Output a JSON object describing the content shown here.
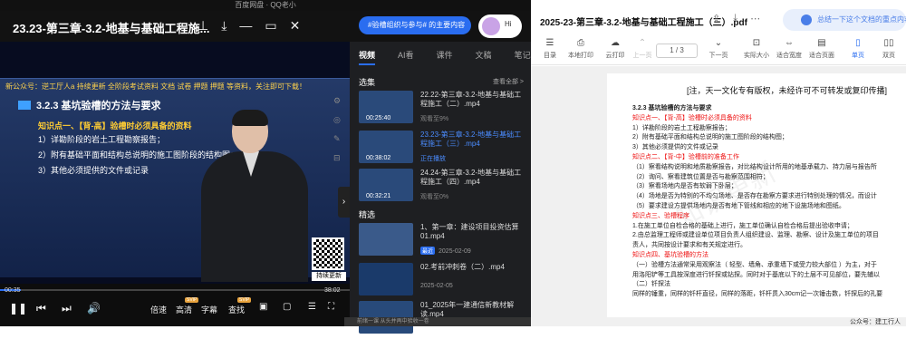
{
  "player": {
    "top_bar": "百度网盘 · QQ老小",
    "title": "23.23-第三章-3.2-地基与基础工程施...",
    "ai_pill": "#验槽组织与参与# 的主要内容",
    "ai_avatar_label": "Hi",
    "icons": [
      "pin-icon",
      "download-icon",
      "minimize-icon",
      "window-icon",
      "close-icon"
    ]
  },
  "slide": {
    "marquee": "新公众号：逆工厅人a 持续更新 全阶段考试资料 文档 试卷 押题 押题 等资料，关注即可下载！",
    "heading": "3.2.3  基坑验槽的方法与要求",
    "point": "知识点一、【背-高】验槽时必须具备的资料",
    "lines": [
      "1）详勘阶段的岩土工程勘察报告；",
      "2）附有基础平面和结构总说明的施工图阶段的结构图；",
      "3）其他必须提供的文件或记录"
    ],
    "qr_label": "持续更新"
  },
  "controls": {
    "time_current": "00:35",
    "time_total": "38:02",
    "progress": 0.06,
    "speed_label": "倍速",
    "quality_label": "高清",
    "subtitle_label": "字幕",
    "search_label": "查找",
    "badge_svip": "SVIP"
  },
  "panel": {
    "tabs": [
      "视频",
      "AI看",
      "课件",
      "文稿",
      "笔记"
    ],
    "active_tab": "视频",
    "selection_title": "选集",
    "see_all": "查看全部 >",
    "episodes": [
      {
        "title": "22.22-第三章-3.2-地基与基础工程施工（二）.mp4",
        "status": "观看至9%",
        "duration": "00:25:40",
        "current": false
      },
      {
        "title": "23.23-第三章-3.2-地基与基础工程施工（三）.mp4",
        "status": "正在播放",
        "duration": "00:38:02",
        "current": true
      },
      {
        "title": "24.24-第三章-3.2-地基与基础工程施工（四）.mp4",
        "status": "观看至0%",
        "duration": "00:32:21",
        "current": false
      }
    ],
    "featured_title": "精选",
    "featured": [
      {
        "title": "1、第一章：建设项目投资估算01.mp4",
        "date": "2025-02-09",
        "tag": "最近"
      },
      {
        "title": "02.考前冲刺卷（二）.mp4",
        "date": "2025-02-05",
        "tag": ""
      },
      {
        "title": "01_2025年一建通信新教材解读.mp4",
        "date": "",
        "tag": ""
      }
    ]
  },
  "pdf": {
    "title": "2025-23-第三章-3.2-地基与基础工程施工（三）.pdf",
    "ai_pill": "总结一下这个文档的重点内容",
    "toolbar": [
      {
        "label": "目录",
        "icon": "list-icon",
        "state": "normal"
      },
      {
        "label": "本地打印",
        "icon": "print-icon",
        "state": "normal"
      },
      {
        "label": "云打印",
        "icon": "cloud-print-icon",
        "state": "normal"
      },
      {
        "label": "上一页",
        "icon": "arrow-up-icon",
        "state": "disabled"
      },
      {
        "label": "下一页",
        "icon": "arrow-down-icon",
        "state": "normal"
      },
      {
        "label": "实际大小",
        "icon": "actual-size-icon",
        "state": "normal"
      },
      {
        "label": "适合宽度",
        "icon": "fit-width-icon",
        "state": "normal"
      },
      {
        "label": "适合页面",
        "icon": "fit-page-icon",
        "state": "normal"
      },
      {
        "label": "单页",
        "icon": "single-page-icon",
        "state": "selected"
      },
      {
        "label": "双页",
        "icon": "double-page-icon",
        "state": "normal"
      }
    ],
    "page_indicator": "1 / 3",
    "copyright": "[注，天一文化专有版权，未经许可不可转发或复印传播]",
    "lines": [
      {
        "text": "3.2.3  基坑验槽的方法与要求",
        "style": "h"
      },
      {
        "text": "知识点一、【背-高】验槽时必须具备的资料",
        "style": "red"
      },
      {
        "text": "1）详勘阶段的岩土工程勘察报告；",
        "style": ""
      },
      {
        "text": "2）附有基础平面和结构总说明的施工图阶段的结构图；",
        "style": ""
      },
      {
        "text": "3）其他必须提供的文件或记录",
        "style": ""
      },
      {
        "text": "知识点二、【背-中】验槽前的准备工作",
        "style": "red"
      },
      {
        "text": "（1）察看结构说明和地质勘察报告，对比结构设计所用的地基承载力、持力层与报告所",
        "style": ""
      },
      {
        "text": "（2）询问、察看建筑位置是否与勘察范围相符；",
        "style": ""
      },
      {
        "text": "（3）察看场地内是否有软弱下卧层；",
        "style": ""
      },
      {
        "text": "（4）场地是否为特别的不均匀场地、是否存在勘察方要求进行特别处理的情况，而设计",
        "style": ""
      },
      {
        "text": "（5）要求建设方提供场地内是否有地下管线和相应的地下设施场地和图纸。",
        "style": ""
      },
      {
        "text": "知识点三、验槽程序",
        "style": "red"
      },
      {
        "text": "1.在施工单位自检合格的基础上进行，施工单位确认自检合格后提出验收申请；",
        "style": ""
      },
      {
        "text": "2.由总监理工程师或建设单位项目负责人组织建设、监理、勘察、设计及施工单位的项目",
        "style": ""
      },
      {
        "text": "责人，共同按设计要求和有关规定进行。",
        "style": ""
      },
      {
        "text": "知识点四、基坑验槽的方法",
        "style": "red"
      },
      {
        "text": "（一）验槽方法通常采用观察法（ 轻型、墙角、承重墙下或受力较大部位 ）为主，对于",
        "style": ""
      },
      {
        "text": "用洛阳铲等工具按深度进行钎探或钻探。同时对于基底以下的土层不可见部位，要先辅以",
        "style": ""
      },
      {
        "text": "（二）钎探法",
        "style": ""
      },
      {
        "text": "同样的锤重，同样的钎杆直径，同样的落距，钎杆贯入30cm记一次锤击数，钎探后的孔要",
        "style": ""
      }
    ],
    "footer": "公众号：建工行人",
    "watermark": "知识更新"
  },
  "under_window": "前绪一课   从头并再中验收一卷"
}
